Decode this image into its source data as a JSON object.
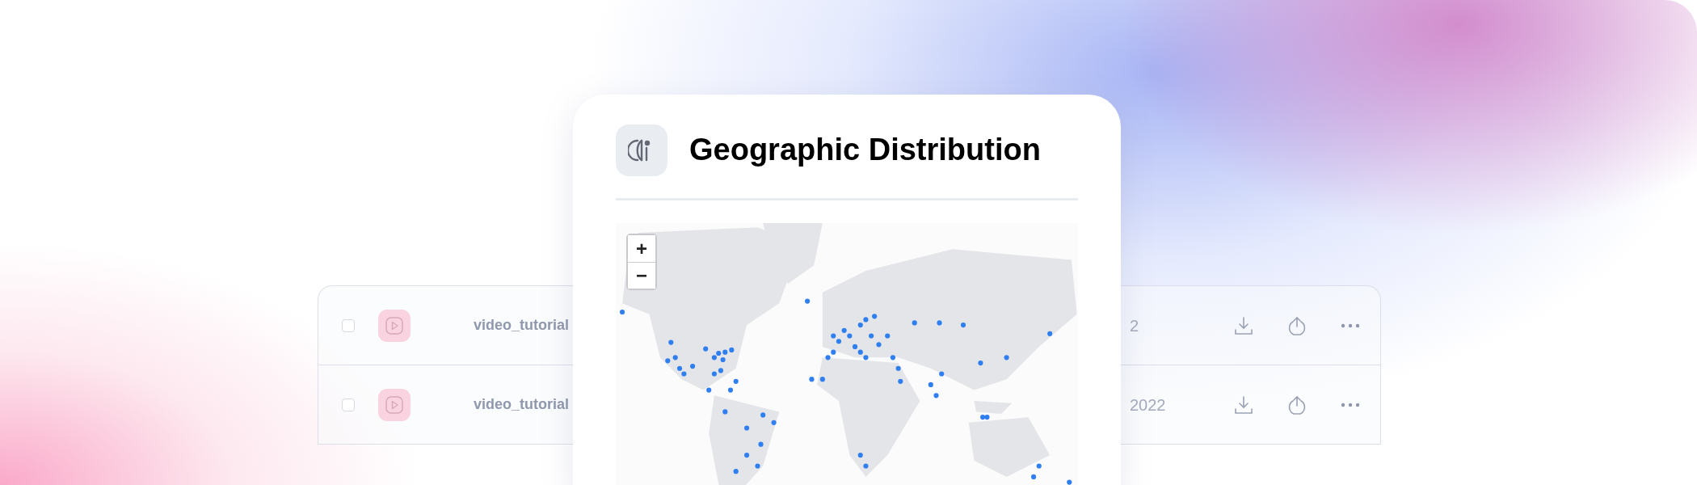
{
  "card": {
    "title": "Geographic Distribution",
    "zoom_controls": [
      "+",
      "−"
    ]
  },
  "table": {
    "rows": [
      {
        "checked": false,
        "file_name": "video_tutorial",
        "date": "2"
      },
      {
        "checked": false,
        "file_name": "video_tutorial",
        "date": "2022"
      }
    ]
  }
}
